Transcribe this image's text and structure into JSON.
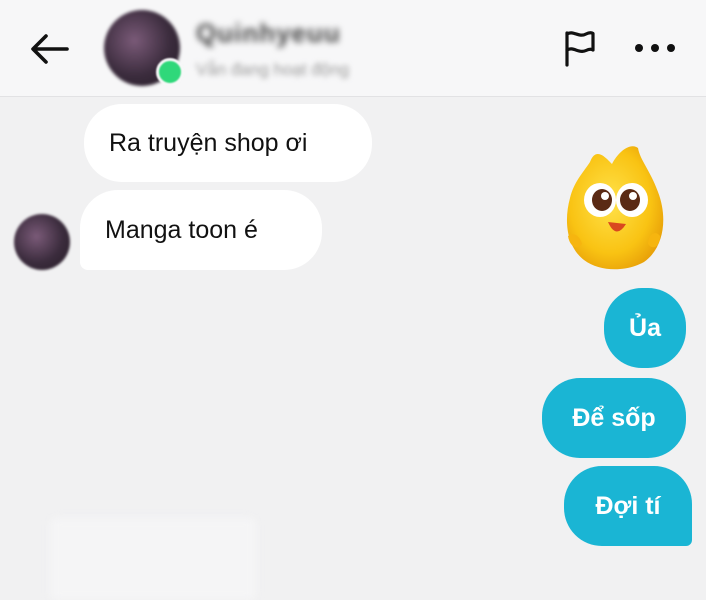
{
  "header": {
    "contact_name": "Quinhyeuu",
    "status": "Vẫn đang hoạt động",
    "back_icon": "arrow-left-icon",
    "flag_icon": "flag-icon",
    "more_icon": "more-horizontal-icon"
  },
  "messages": [
    {
      "from": "contact",
      "text": "Ra truyện shop ơi"
    },
    {
      "from": "contact",
      "text": "Manga toon é"
    },
    {
      "from": "me",
      "type": "sticker",
      "sticker": "yellow-flame-mascot"
    },
    {
      "from": "me",
      "text": "Ủa"
    },
    {
      "from": "me",
      "text": "Để sốp"
    },
    {
      "from": "me",
      "text": "Đợi tí"
    }
  ],
  "colors": {
    "outgoing_bubble": "#1ab5d4",
    "incoming_bubble": "#ffffff",
    "background": "#f1f1f2",
    "online": "#2fd87a"
  }
}
